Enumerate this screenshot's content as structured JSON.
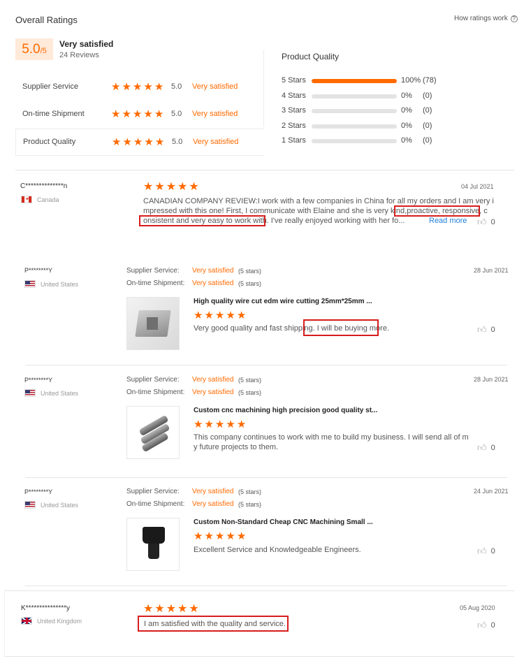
{
  "header": {
    "title": "Overall Ratings",
    "how_link": "How ratings work"
  },
  "summary": {
    "score": "5.0",
    "out_of": "/5",
    "verdict": "Very satisfied",
    "reviews_count": "24 Reviews"
  },
  "rating_rows": [
    {
      "label": "Supplier Service",
      "score": "5.0",
      "verdict": "Very satisfied"
    },
    {
      "label": "On-time Shipment",
      "score": "5.0",
      "verdict": "Very satisfied"
    },
    {
      "label": "Product Quality",
      "score": "5.0",
      "verdict": "Very satisfied"
    }
  ],
  "quality": {
    "title": "Product Quality",
    "rows": [
      {
        "label": "5 Stars",
        "pct": "100%",
        "count": "(78)",
        "fraction": 1.0
      },
      {
        "label": "4 Stars",
        "pct": "0%",
        "count": "(0)",
        "fraction": 0
      },
      {
        "label": "3 Stars",
        "pct": "0%",
        "count": "(0)",
        "fraction": 0
      },
      {
        "label": "2 Stars",
        "pct": "0%",
        "count": "(0)",
        "fraction": 0
      },
      {
        "label": "1 Stars",
        "pct": "0%",
        "count": "(0)",
        "fraction": 0
      }
    ]
  },
  "reviews": {
    "r1": {
      "user": "C**************n",
      "country": "Canada",
      "date": "04 Jul 2021",
      "rating": 5,
      "line1": "CANADIAN COMPANY REVIEW:I work with a few companies in China for all my orders and I am very i",
      "line2a": "mpressed with this one! First, I communicate with Elaine and she is very kind,",
      "line2b": "proactive, responsive, c",
      "line3a": "onsistent and very easy to work with.",
      "line3b": "I've really enjoyed working with her fo...",
      "read_more": "Read more",
      "likes": "0"
    },
    "r2": {
      "user": "P********Y",
      "country": "United States",
      "date": "28 Jun 2021",
      "supplier_label": "Supplier Service:",
      "supplier_value": "Very satisfied",
      "supplier_stars": "(5 stars)",
      "shipment_label": "On-time Shipment:",
      "shipment_value": "Very satisfied",
      "shipment_stars": "(5 stars)",
      "product_title": "High quality wire cut edm wire cutting 25mm*25mm ...",
      "rating": 5,
      "text_a": "Very good quality and fast shipping.",
      "text_b": "I will be buying more.",
      "likes": "0"
    },
    "r3": {
      "user": "P********Y",
      "country": "United States",
      "date": "28 Jun 2021",
      "supplier_label": "Supplier Service:",
      "supplier_value": "Very satisfied",
      "supplier_stars": "(5 stars)",
      "shipment_label": "On-time Shipment:",
      "shipment_value": "Very satisfied",
      "shipment_stars": "(5 stars)",
      "product_title": "Custom cnc machining high precision good quality st...",
      "rating": 5,
      "text1": "This company continues to work with me to build my business. I will send all of m",
      "text2": "y future projects to them.",
      "likes": "0"
    },
    "r4": {
      "user": "P********Y",
      "country": "United States",
      "date": "24 Jun 2021",
      "supplier_label": "Supplier Service:",
      "supplier_value": "Very satisfied",
      "supplier_stars": "(5 stars)",
      "shipment_label": "On-time Shipment:",
      "shipment_value": "Very satisfied",
      "shipment_stars": "(5 stars)",
      "product_title": "Custom Non-Standard Cheap CNC Machining Small ...",
      "rating": 5,
      "text1": "Excellent Service and Knowledgeable Engineers.",
      "likes": "0"
    },
    "r5": {
      "user": "K***************y",
      "country": "United Kingdom",
      "date": "05 Aug 2020",
      "rating": 5,
      "text1": "I am satisfied with the quality and service.",
      "likes": "0"
    }
  },
  "colors": {
    "accent": "#ff6a00",
    "highlight_box": "#d71d1d",
    "score_bg": "#ffe9d9"
  }
}
